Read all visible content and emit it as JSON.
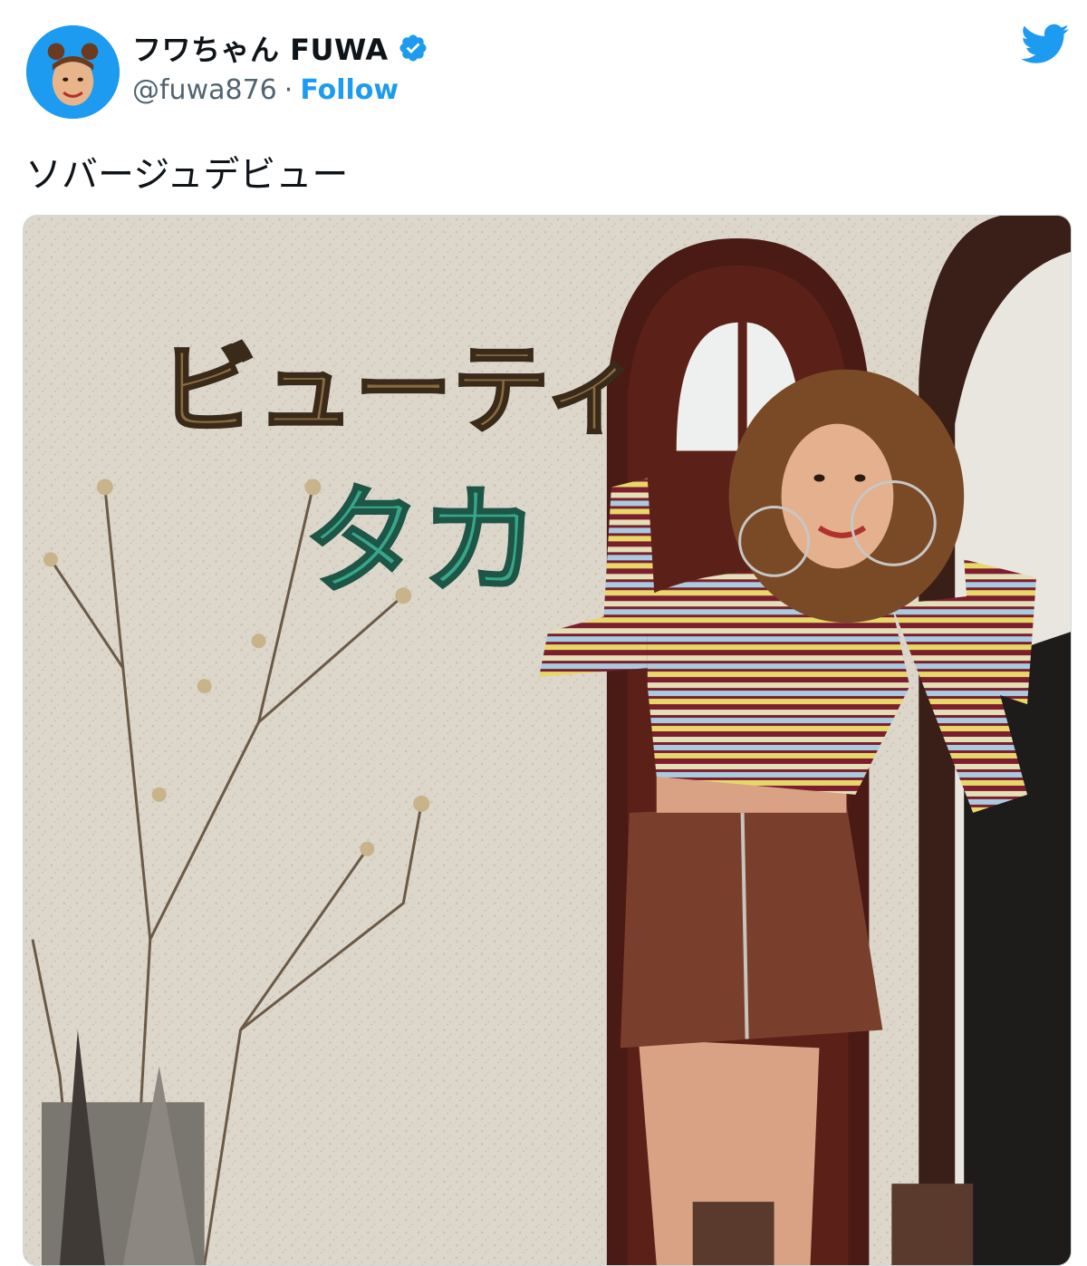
{
  "tweet": {
    "display_name": "フワちゃん FUWA",
    "handle": "@fuwa876",
    "separator": "·",
    "follow_label": "Follow",
    "text": "ソバージュデビュー",
    "verified": true
  },
  "photo": {
    "sign_line1": "ビューティ",
    "sign_line2": "タカ"
  },
  "icons": {
    "brand": "twitter-bird-icon",
    "badge": "verified-badge-icon"
  },
  "colors": {
    "accent": "#1d9bf0",
    "text": "#0f1419",
    "muted": "#536471"
  }
}
